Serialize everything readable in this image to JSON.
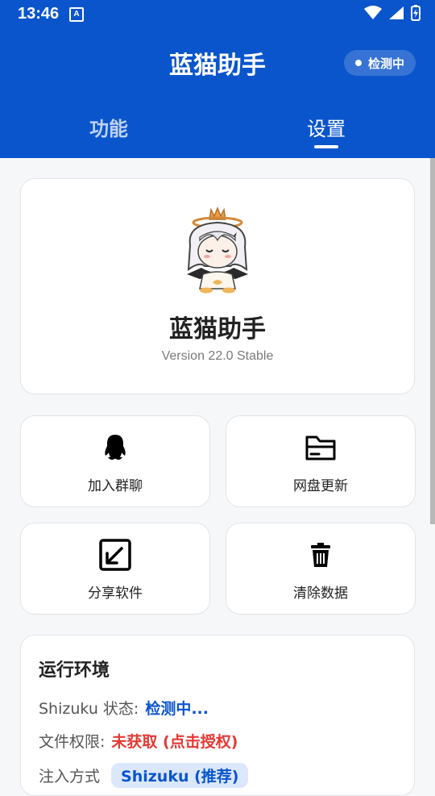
{
  "status_bar": {
    "time": "13:46",
    "a_icon": "A"
  },
  "app_bar": {
    "title": "蓝猫助手",
    "status_chip": "检测中",
    "tabs": [
      {
        "label": "功能",
        "selected": false
      },
      {
        "label": "设置",
        "selected": true
      }
    ]
  },
  "hero": {
    "app_name": "蓝猫助手",
    "version": "Version 22.0 Stable",
    "mascot_icon": "chibi-character-icon"
  },
  "actions": [
    {
      "label": "加入群聊",
      "icon": "qq-penguin-icon"
    },
    {
      "label": "网盘更新",
      "icon": "folder-icon"
    },
    {
      "label": "分享软件",
      "icon": "share-arrow-icon"
    },
    {
      "label": "清除数据",
      "icon": "trash-icon"
    }
  ],
  "environment": {
    "title": "运行环境",
    "rows": [
      {
        "label": "Shizuku 状态:",
        "value": "检测中..."
      },
      {
        "label": "文件权限:",
        "value": "未获取 (点击授权)"
      },
      {
        "label": "注入方式",
        "value": "Shizuku (推荐)"
      }
    ]
  },
  "colors": {
    "primary": "#0a55cc",
    "error": "#e53935",
    "background": "#f6f7f9"
  }
}
